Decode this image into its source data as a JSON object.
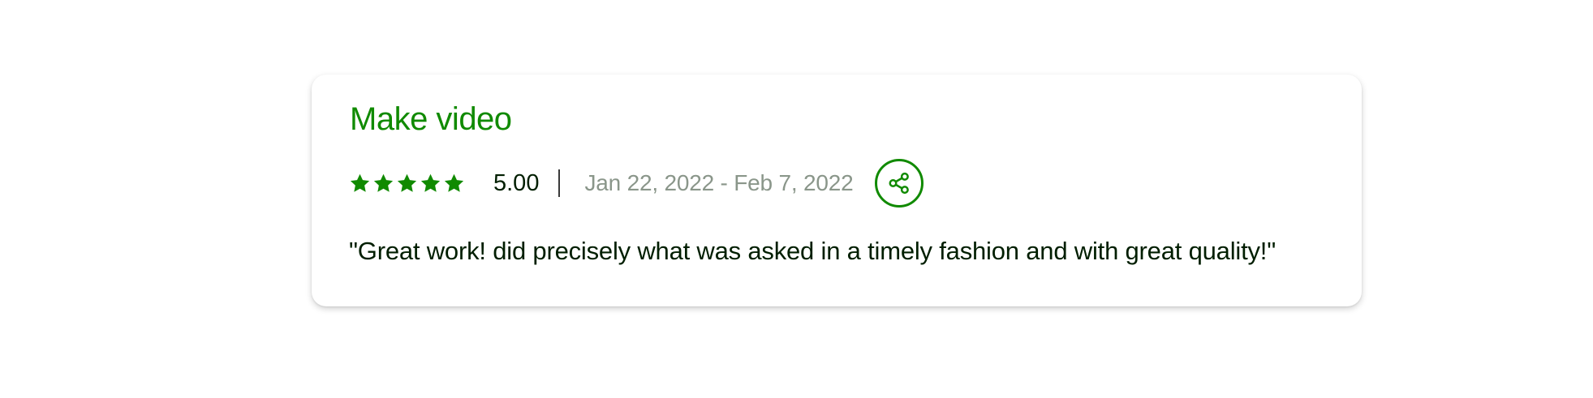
{
  "review": {
    "title": "Make video",
    "rating_value": "5.00",
    "rating_fraction": 1.0,
    "star_count": 5,
    "date_range": "Jan 22, 2022 - Feb 7, 2022",
    "feedback": "\"Great work! did precisely what was asked in a timely fashion and with great quality!\"",
    "share_icon": "share-icon",
    "star_icon": "star-icon"
  },
  "colors": {
    "accent": "#108a00",
    "text": "#001e00",
    "muted": "#8a968a",
    "background": "#ffffff"
  }
}
